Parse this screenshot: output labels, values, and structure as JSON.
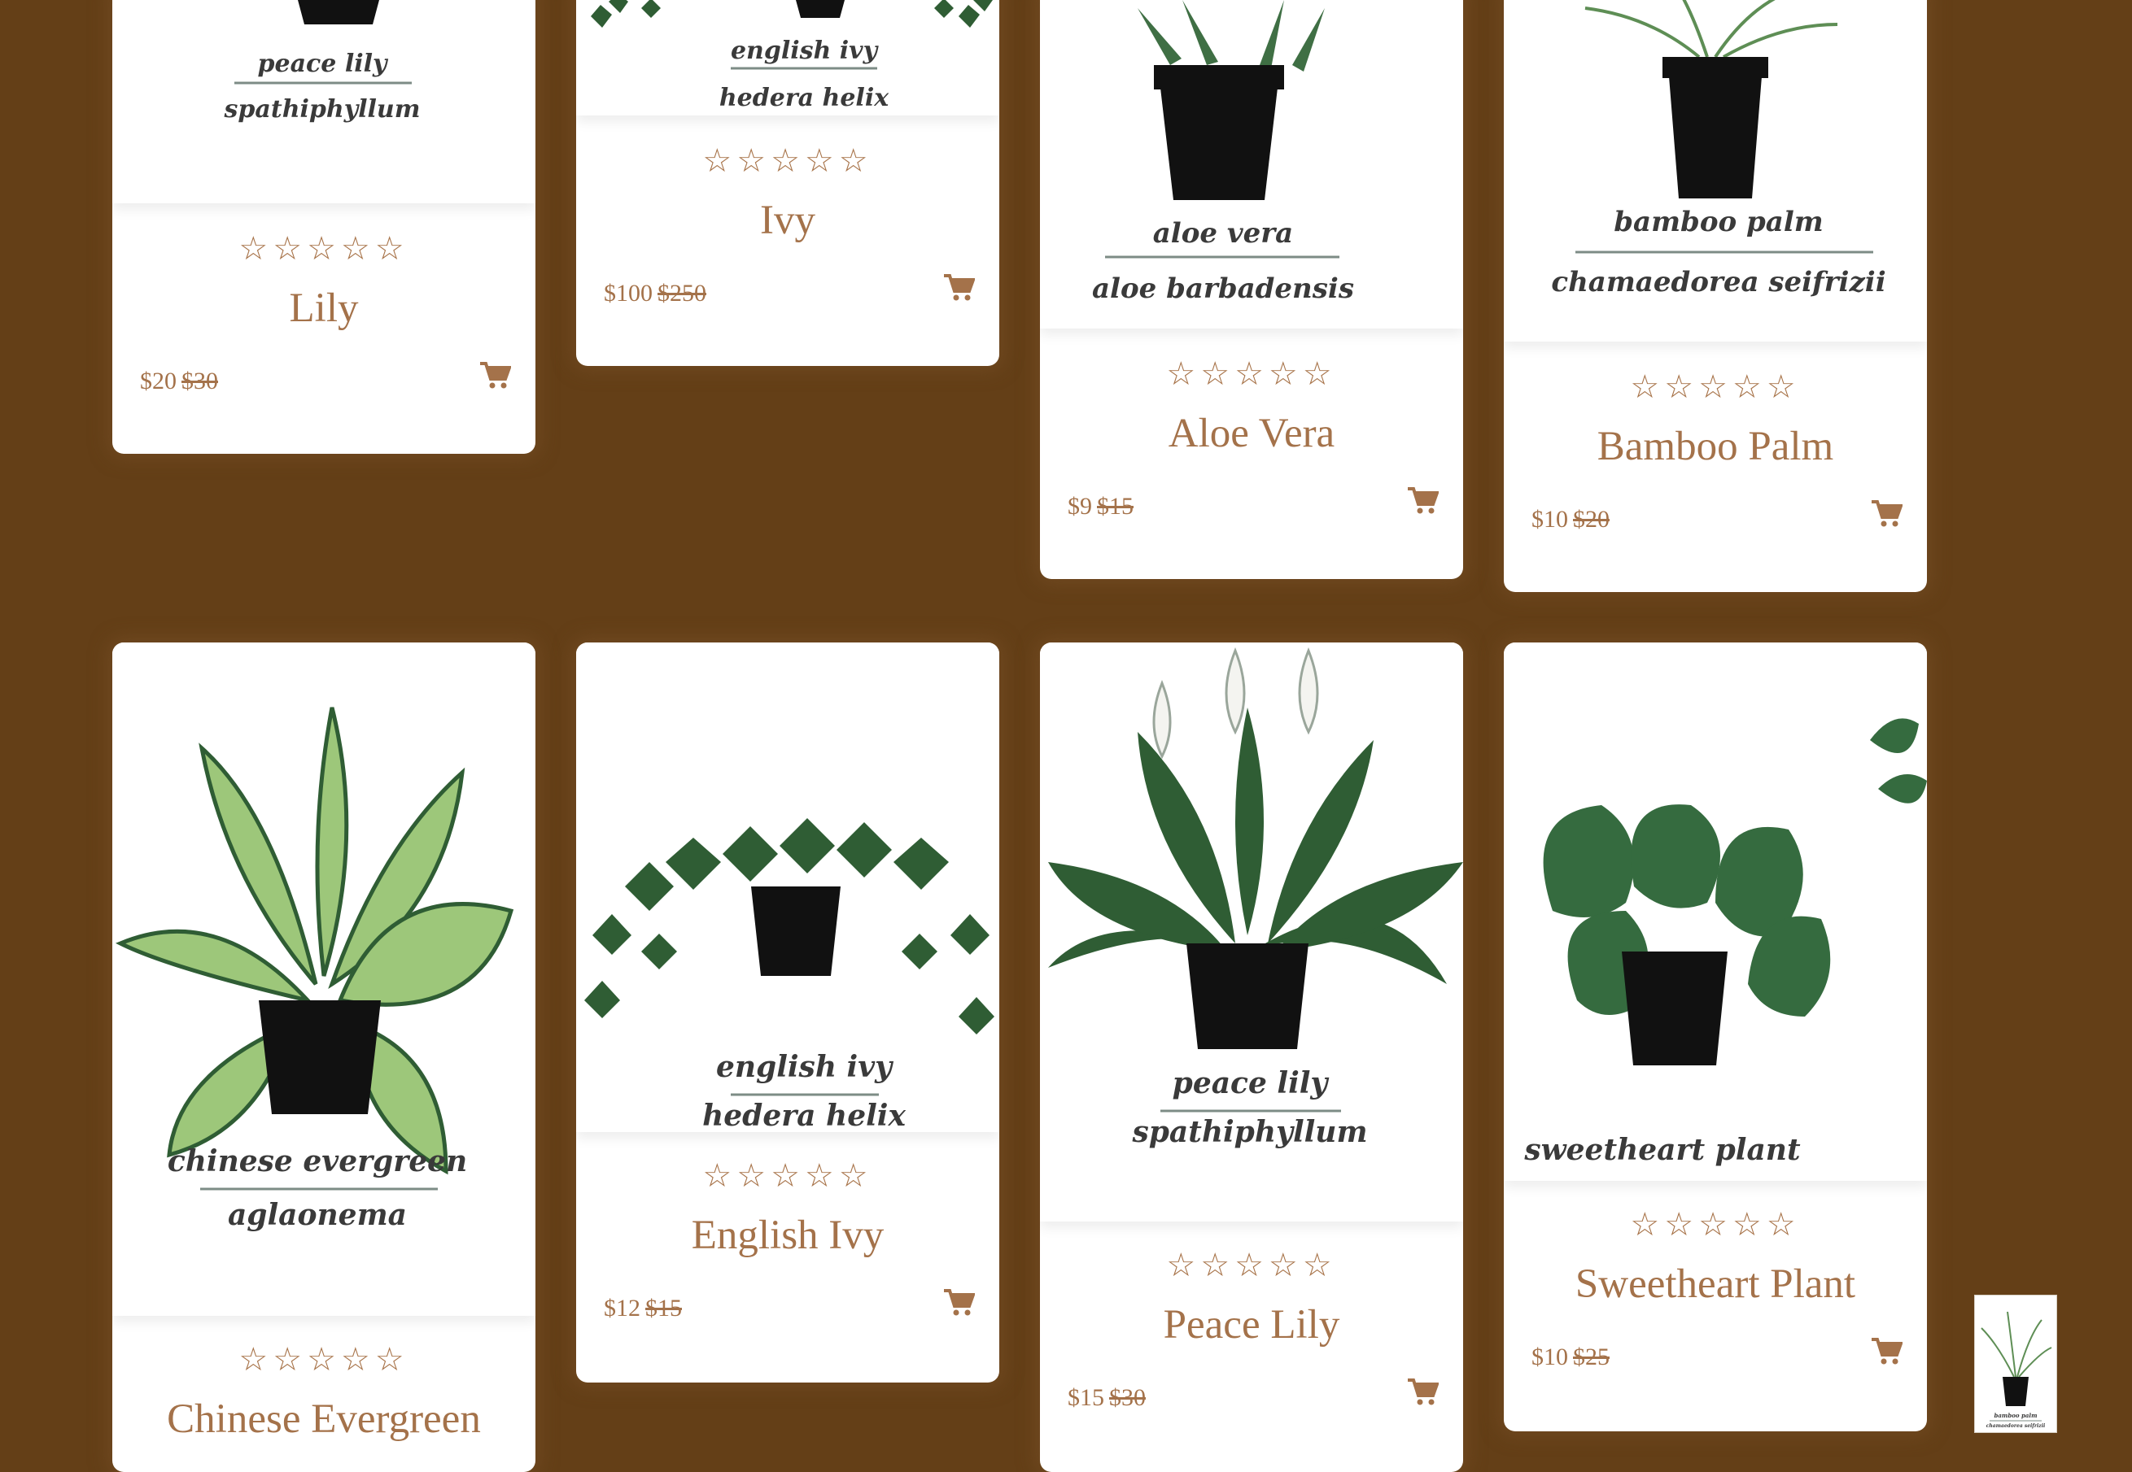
{
  "products": [
    {
      "name": "Lily",
      "price": "$20",
      "old_price": "$30",
      "rating": "☆☆☆☆☆",
      "label_common": "peace lily",
      "label_latin": "spathiphyllum"
    },
    {
      "name": "Ivy",
      "price": "$100",
      "old_price": "$250",
      "rating": "☆☆☆☆☆",
      "label_common": "english ivy",
      "label_latin": "hedera helix"
    },
    {
      "name": "Aloe Vera",
      "price": "$9",
      "old_price": "$15",
      "rating": "☆☆☆☆☆",
      "label_common": "aloe vera",
      "label_latin": "aloe barbadensis"
    },
    {
      "name": "Bamboo Palm",
      "price": "$10",
      "old_price": "$20",
      "rating": "☆☆☆☆☆",
      "label_common": "bamboo palm",
      "label_latin": "chamaedorea seifrizii"
    },
    {
      "name": "Chinese Evergreen",
      "price": "",
      "old_price": "",
      "rating": "☆☆☆☆☆",
      "label_common": "chinese evergreen",
      "label_latin": "aglaonema"
    },
    {
      "name": "English Ivy",
      "price": "$12",
      "old_price": "$15",
      "rating": "☆☆☆☆☆",
      "label_common": "english ivy",
      "label_latin": "hedera helix"
    },
    {
      "name": "Peace Lily",
      "price": "$15",
      "old_price": "$30",
      "rating": "☆☆☆☆☆",
      "label_common": "peace lily",
      "label_latin": "spathiphyllum"
    },
    {
      "name": "Sweetheart Plant",
      "price": "$10",
      "old_price": "$25",
      "rating": "☆☆☆☆☆",
      "label_common": "sweetheart plant",
      "label_latin": ""
    }
  ],
  "thumbnail": {
    "label_common": "bamboo palm",
    "label_latin": "chamaedorea seifrizii"
  },
  "icons": {
    "rating": "star-outline-icon",
    "cart": "shopping-cart-icon"
  },
  "colors": {
    "background": "#643f17",
    "card": "#ffffff",
    "accent": "#a4724a",
    "leaf": "#2f5d34",
    "pot": "#111111"
  }
}
